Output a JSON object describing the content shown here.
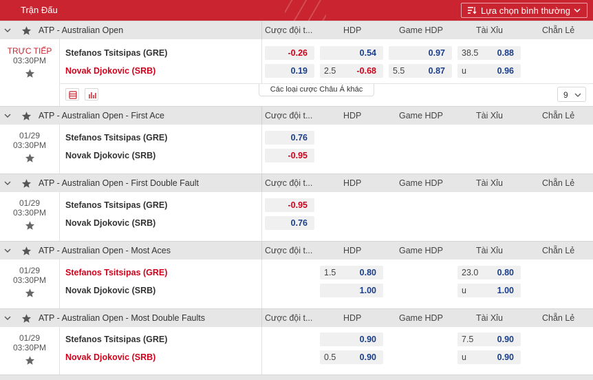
{
  "header": {
    "title": "Trận Đấu",
    "sort_label": "Lựa chọn bình thường"
  },
  "columns": {
    "c1": "Cược đội t...",
    "c2": "HDP",
    "c3": "Game HDP",
    "c4": "Tài Xỉu",
    "c5": "Chẵn Lẻ"
  },
  "teams": {
    "home": "Stefanos Tsitsipas (GRE)",
    "away": "Novak Djokovic (SRB)"
  },
  "sections": [
    {
      "league": "ATP - Australian Open",
      "status": "TRỰC TIẾP",
      "time": "03:30PM",
      "moneyline": [
        "-0.26",
        "0.19"
      ],
      "hdp_line": [
        "",
        "2.5"
      ],
      "hdp_odds": [
        "0.54",
        "-0.68"
      ],
      "game_line": [
        "",
        "5.5"
      ],
      "game_odds": [
        "0.97",
        "0.87"
      ],
      "ou_line": [
        "38.5",
        "u"
      ],
      "ou_odds": [
        "0.88",
        "0.96"
      ],
      "more_label": "Các loại cược Châu Á khác",
      "more_count": "9"
    },
    {
      "league": "ATP - Australian Open - First Ace",
      "date": "01/29",
      "time": "03:30PM",
      "moneyline": [
        "0.76",
        "-0.95"
      ]
    },
    {
      "league": "ATP - Australian Open - First Double Fault",
      "date": "01/29",
      "time": "03:30PM",
      "moneyline": [
        "-0.95",
        "0.76"
      ]
    },
    {
      "league": "ATP - Australian Open - Most Aces",
      "date": "01/29",
      "time": "03:30PM",
      "hdp_line": [
        "1.5",
        ""
      ],
      "hdp_odds": [
        "0.80",
        "1.00"
      ],
      "ou_line": [
        "23.0",
        "u"
      ],
      "ou_odds": [
        "0.80",
        "1.00"
      ]
    },
    {
      "league": "ATP - Australian Open - Most Double Faults",
      "date": "01/29",
      "time": "03:30PM",
      "hdp_line": [
        "",
        "0.5"
      ],
      "hdp_odds": [
        "0.90",
        "0.90"
      ],
      "ou_line": [
        "7.5",
        "u"
      ],
      "ou_odds": [
        "0.90",
        "0.90"
      ]
    }
  ]
}
